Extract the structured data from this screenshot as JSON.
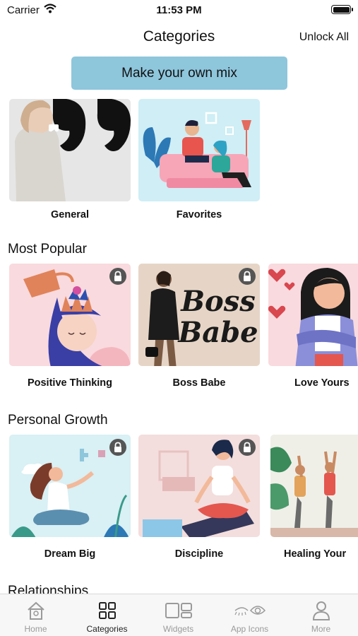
{
  "status_bar": {
    "carrier": "Carrier",
    "time": "11:53 PM"
  },
  "nav": {
    "title": "Categories",
    "unlock_all": "Unlock All"
  },
  "mix_button": {
    "label": "Make your own mix"
  },
  "sections": {
    "top": {
      "items": [
        {
          "label": "General",
          "locked": false
        },
        {
          "label": "Favorites",
          "locked": false
        }
      ]
    },
    "most_popular": {
      "title": "Most Popular",
      "items": [
        {
          "label": "Positive Thinking",
          "locked": true
        },
        {
          "label": "Boss Babe",
          "locked": true,
          "art_text_1": "Boss",
          "art_text_2": "Babe"
        },
        {
          "label": "Love Yours",
          "locked": false
        }
      ]
    },
    "personal_growth": {
      "title": "Personal Growth",
      "items": [
        {
          "label": "Dream Big",
          "locked": true
        },
        {
          "label": "Discipline",
          "locked": true
        },
        {
          "label": "Healing Your",
          "locked": false
        }
      ]
    },
    "relationships": {
      "title": "Relationships"
    }
  },
  "tab_bar": {
    "tabs": [
      {
        "label": "Home",
        "icon": "home-icon",
        "active": false
      },
      {
        "label": "Categories",
        "icon": "categories-grid-icon",
        "active": true
      },
      {
        "label": "Widgets",
        "icon": "widgets-icon",
        "active": false
      },
      {
        "label": "App Icons",
        "icon": "app-icons-eye-icon",
        "active": false
      },
      {
        "label": "More",
        "icon": "person-icon",
        "active": false
      }
    ]
  },
  "colors": {
    "accent_button": "#8ec6dc",
    "lock_badge": "#555555",
    "tab_active": "#222222",
    "tab_inactive": "#9a9a9a"
  }
}
